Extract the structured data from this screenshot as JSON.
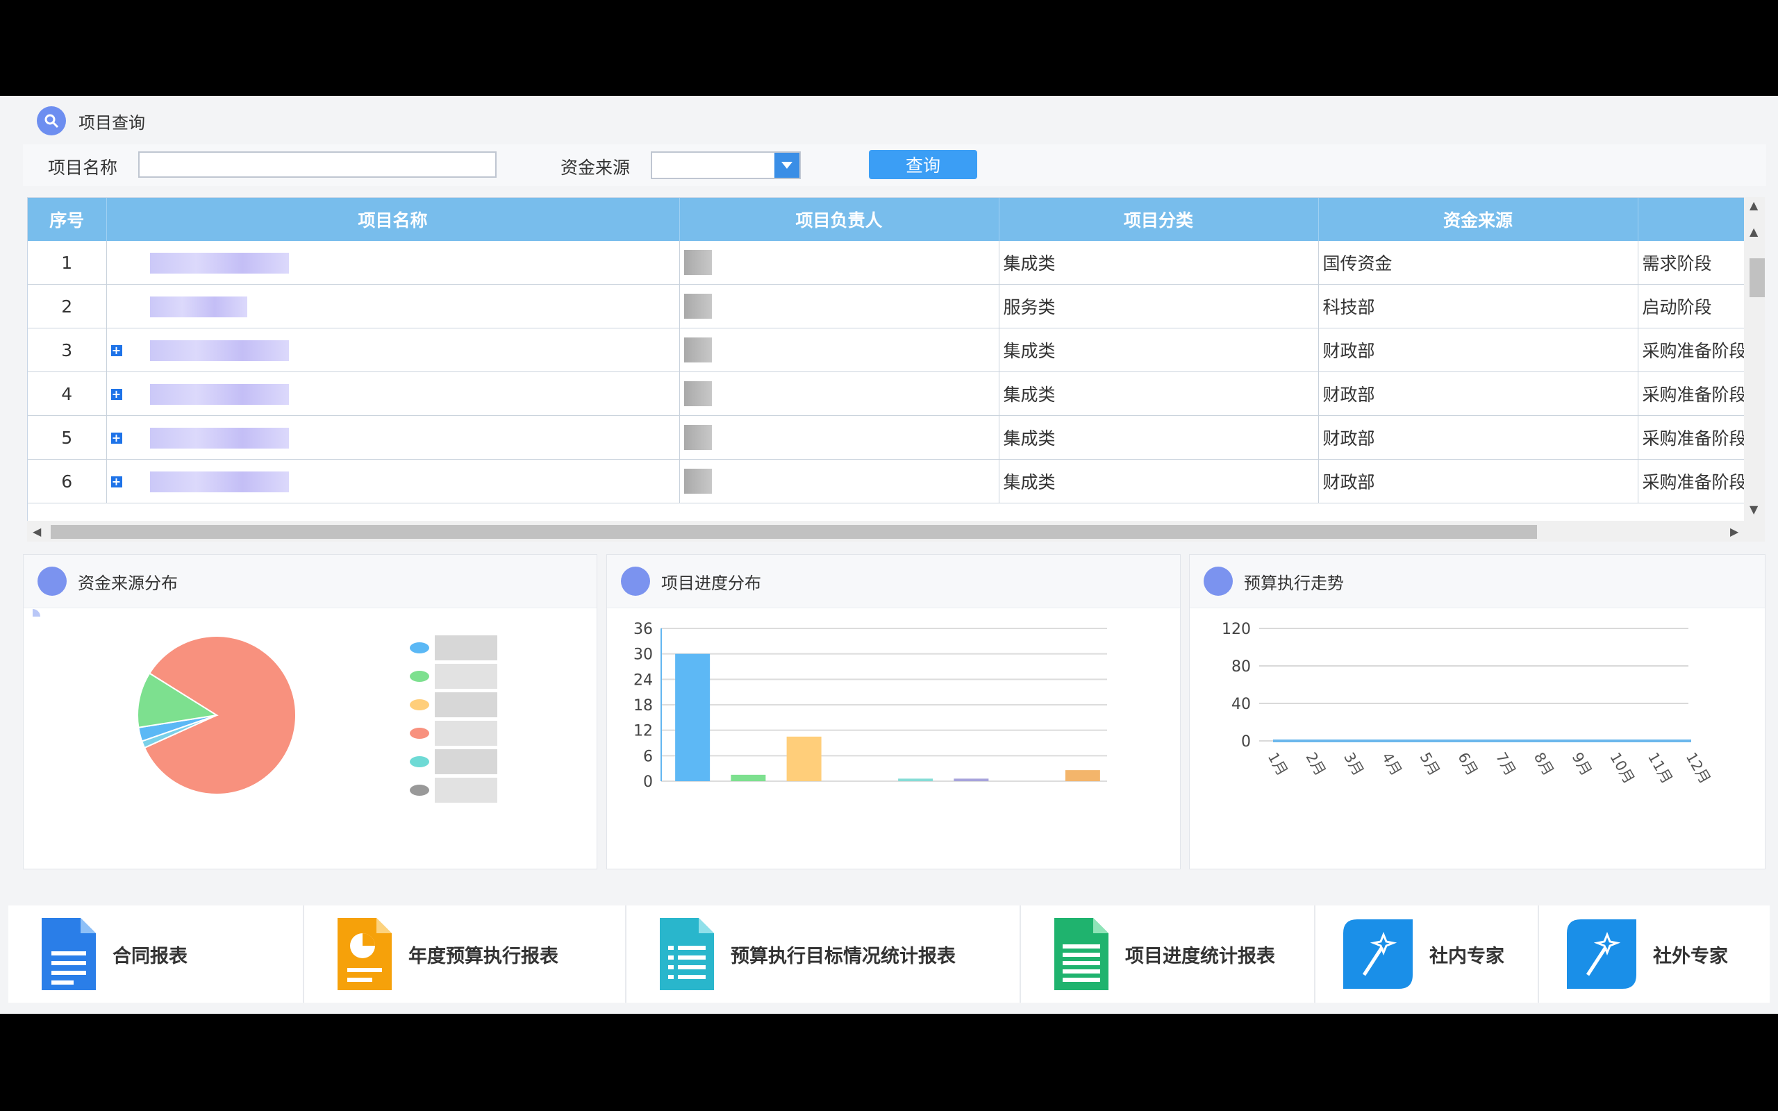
{
  "query": {
    "title": "项目查询",
    "name_label": "项目名称",
    "name_value": "",
    "fund_label": "资金来源",
    "fund_value": "",
    "query_button": "查询"
  },
  "table": {
    "columns": [
      "序号",
      "项目名称",
      "项目负责人",
      "项目分类",
      "资金来源",
      ""
    ],
    "rows": [
      {
        "idx": "1",
        "expand": false,
        "category": "集成类",
        "source": "国传资金",
        "stage": "需求阶段"
      },
      {
        "idx": "2",
        "expand": false,
        "category": "服务类",
        "source": "科技部",
        "stage": "启动阶段"
      },
      {
        "idx": "3",
        "expand": true,
        "category": "集成类",
        "source": "财政部",
        "stage": "采购准备阶段"
      },
      {
        "idx": "4",
        "expand": true,
        "category": "集成类",
        "source": "财政部",
        "stage": "采购准备阶段"
      },
      {
        "idx": "5",
        "expand": true,
        "category": "集成类",
        "source": "财政部",
        "stage": "采购准备阶段"
      },
      {
        "idx": "6",
        "expand": true,
        "category": "集成类",
        "source": "财政部",
        "stage": "采购准备阶段"
      }
    ]
  },
  "charts_titles": {
    "pie": "资金来源分布",
    "bar": "项目进度分布",
    "line": "预算执行走势"
  },
  "chart_data": [
    {
      "type": "pie",
      "values": [
        89,
        1.5,
        3,
        12
      ],
      "colors": [
        "#f8917e",
        "#7ad0e8",
        "#5bb8f5",
        "#7de08f"
      ],
      "legend_colors": [
        "#5bb8f5",
        "#7de08f",
        "#ffce7a",
        "#f8917e",
        "#6edad5",
        "#999999"
      ]
    },
    {
      "type": "bar",
      "categories": [
        "",
        "",
        "",
        "",
        "",
        "",
        "",
        ""
      ],
      "values": [
        30,
        1.5,
        10.5,
        0,
        0.6,
        0.6,
        0,
        2.6
      ],
      "colors": [
        "#5db8f5",
        "#7de08f",
        "#ffce7a",
        "#f8917e",
        "#86dcd6",
        "#a7a3db",
        "#c7c7c7",
        "#f3b56b"
      ],
      "yticks": [
        0,
        6,
        12,
        18,
        24,
        30,
        36
      ],
      "ylim": [
        0,
        36
      ]
    },
    {
      "type": "line",
      "categories": [
        "1月",
        "2月",
        "3月",
        "4月",
        "5月",
        "6月",
        "7月",
        "8月",
        "9月",
        "10月",
        "11月",
        "12月"
      ],
      "values": [
        0,
        0,
        0,
        0,
        0,
        0,
        0,
        0,
        0,
        0,
        0,
        0
      ],
      "yticks": [
        0,
        40,
        80,
        120
      ],
      "ylim": [
        0,
        120
      ]
    }
  ],
  "bottom_links": [
    {
      "label": "合同报表",
      "color": "#2a7ee8"
    },
    {
      "label": "年度预算执行报表",
      "color": "#f6a10a"
    },
    {
      "label": "预算执行目标情况统计报表",
      "color": "#29b6cc"
    },
    {
      "label": "项目进度统计报表",
      "color": "#1fb36e"
    },
    {
      "label": "社内专家",
      "color": "#1a8fe8"
    },
    {
      "label": "社外专家",
      "color": "#1a8fe8"
    }
  ]
}
